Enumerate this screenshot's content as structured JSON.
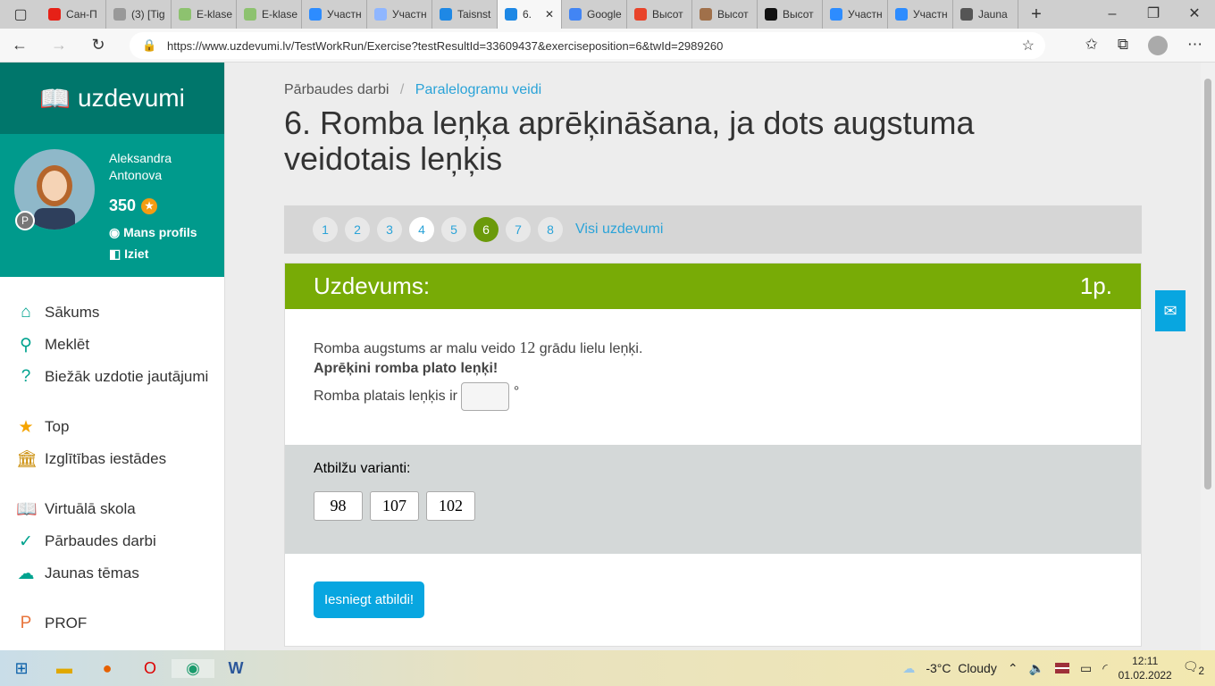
{
  "browser": {
    "tabs": [
      {
        "label": "Сан-П",
        "color": "#e62117"
      },
      {
        "label": "(3) [Tig",
        "color": "#999"
      },
      {
        "label": "E-klase",
        "color": "#8dc26f"
      },
      {
        "label": "E-klase",
        "color": "#8dc26f"
      },
      {
        "label": "Участн",
        "color": "#2d8cff"
      },
      {
        "label": "Участн",
        "color": "#8fb6ff"
      },
      {
        "label": "Taisnst",
        "color": "#1e88e5"
      },
      {
        "label": "6.",
        "color": "#1e88e5"
      },
      {
        "label": "Google",
        "color": "#4285f4"
      },
      {
        "label": "Высот",
        "color": "#e8432a"
      },
      {
        "label": "Высот",
        "color": "#a0704a"
      },
      {
        "label": "Высот",
        "color": "#111"
      },
      {
        "label": "Участн",
        "color": "#2d8cff"
      },
      {
        "label": "Участн",
        "color": "#2d8cff"
      },
      {
        "label": "Jauna",
        "color": "#555"
      }
    ],
    "url": "https://www.uzdevumi.lv/TestWorkRun/Exercise?testResultId=33609437&exerciseposition=6&twId=2989260"
  },
  "sidebar": {
    "logo": "uzdevumi",
    "user": "Aleksandra Antonova",
    "points": "350",
    "profile_badge": "P",
    "my_profile": "Mans profils",
    "logout": "Iziet",
    "menu": [
      {
        "label": "Sākums",
        "icon": "⌂"
      },
      {
        "label": "Meklēt",
        "icon": "⚲"
      },
      {
        "label": "Biežāk uzdotie jautājumi",
        "icon": "?"
      },
      {
        "label": "Top",
        "icon": "★"
      },
      {
        "label": "Izglītības iestādes",
        "icon": "🏛"
      },
      {
        "label": "Virtuālā skola",
        "icon": "📖"
      },
      {
        "label": "Pārbaudes darbi",
        "icon": "✓"
      },
      {
        "label": "Jaunas tēmas",
        "icon": "☁"
      },
      {
        "label": "PROF",
        "icon": "P"
      }
    ]
  },
  "main": {
    "breadcrumb": [
      "Pārbaudes darbi",
      "Paralelogramu veidi"
    ],
    "title": "6. Romba leņķa aprēķināšana, ja dots augstuma veidotais leņķis",
    "pages": [
      "1",
      "2",
      "3",
      "4",
      "5",
      "6",
      "7",
      "8"
    ],
    "all_tasks": "Visi uzdevumi",
    "task_header": "Uzdevums:",
    "task_points": "1p.",
    "line1_a": "Romba augstums ar malu veido ",
    "line1_num": "12",
    "line1_b": " grādu lielu leņķi.",
    "line2": "Aprēķini romba plato leņķi!",
    "line3": "Romba platais leņķis ir",
    "degree": "°",
    "options_label": "Atbilžu varianti:",
    "options": [
      "98",
      "107",
      "102"
    ],
    "submit": "Iesniegt atbildi!"
  },
  "taskbar": {
    "weather": "-3°C  Cloudy",
    "time": "12:11",
    "date": "01.02.2022",
    "notifications": "2"
  }
}
